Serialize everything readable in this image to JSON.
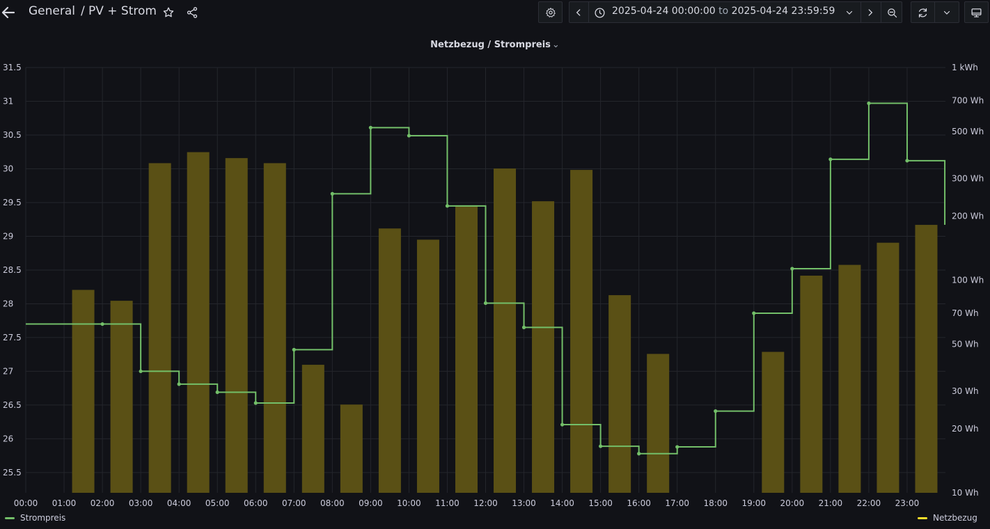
{
  "header": {
    "crumb_general": "General",
    "crumb_separator": "/",
    "crumb_page": "PV + Strom",
    "time_from": "2025-04-24 00:00:00",
    "time_to_word": "to",
    "time_to": "2025-04-24 23:59:59"
  },
  "panel": {
    "title": "Netzbezug / Strompreis"
  },
  "colors": {
    "price_line": "#73bf69",
    "bar_fill": "#5a5015",
    "legend_netzbezug": "#fade2a",
    "grid": "#24262c",
    "axis_text": "#ccccdc"
  },
  "icons": [
    "arrow-left-icon",
    "star-icon",
    "share-icon",
    "gear-icon",
    "chevron-left-icon",
    "clock-icon",
    "chevron-down-icon",
    "chevron-right-icon",
    "zoom-out-icon",
    "refresh-icon",
    "monitor-icon"
  ],
  "chart_data": {
    "type": "bar",
    "title": "Netzbezug / Strompreis",
    "x_ticks": [
      "00:00",
      "01:00",
      "02:00",
      "03:00",
      "04:00",
      "05:00",
      "06:00",
      "07:00",
      "08:00",
      "09:00",
      "10:00",
      "11:00",
      "12:00",
      "13:00",
      "14:00",
      "15:00",
      "16:00",
      "17:00",
      "18:00",
      "19:00",
      "20:00",
      "21:00",
      "22:00",
      "23:00"
    ],
    "y_left": {
      "ticks": [
        "25.5",
        "26",
        "26.5",
        "27",
        "27.5",
        "28",
        "28.5",
        "29",
        "29.5",
        "30",
        "30.5",
        "31",
        "31.5"
      ],
      "range": [
        25.2,
        31.5
      ]
    },
    "y_right": {
      "scale": "log",
      "range_wh": [
        10,
        1000
      ],
      "ticks": [
        {
          "wh": 1000,
          "label": "1 kWh"
        },
        {
          "wh": 700,
          "label": "700 Wh"
        },
        {
          "wh": 500,
          "label": "500 Wh"
        },
        {
          "wh": 300,
          "label": "300 Wh"
        },
        {
          "wh": 200,
          "label": "200 Wh"
        },
        {
          "wh": 100,
          "label": "100 Wh"
        },
        {
          "wh": 70,
          "label": "70 Wh"
        },
        {
          "wh": 50,
          "label": "50 Wh"
        },
        {
          "wh": 30,
          "label": "30 Wh"
        },
        {
          "wh": 20,
          "label": "20 Wh"
        },
        {
          "wh": 10,
          "label": "10 Wh"
        }
      ]
    },
    "series": [
      {
        "name": "Strompreis",
        "type": "line-step",
        "axis": "left",
        "points": [
          {
            "x": "00:00",
            "y": 27.7
          },
          {
            "x": "02:00",
            "y": 27.7
          },
          {
            "x": "03:00",
            "y": 27.0
          },
          {
            "x": "04:00",
            "y": 26.81
          },
          {
            "x": "05:00",
            "y": 26.69
          },
          {
            "x": "06:00",
            "y": 26.53
          },
          {
            "x": "07:00",
            "y": 27.32
          },
          {
            "x": "08:00",
            "y": 29.63
          },
          {
            "x": "09:00",
            "y": 30.61
          },
          {
            "x": "10:00",
            "y": 30.49
          },
          {
            "x": "11:00",
            "y": 29.45
          },
          {
            "x": "12:00",
            "y": 28.01
          },
          {
            "x": "13:00",
            "y": 27.65
          },
          {
            "x": "14:00",
            "y": 26.21
          },
          {
            "x": "15:00",
            "y": 25.89
          },
          {
            "x": "16:00",
            "y": 25.78
          },
          {
            "x": "17:00",
            "y": 25.88
          },
          {
            "x": "18:00",
            "y": 26.41
          },
          {
            "x": "19:00",
            "y": 27.86
          },
          {
            "x": "20:00",
            "y": 28.52
          },
          {
            "x": "21:00",
            "y": 30.14
          },
          {
            "x": "22:00",
            "y": 30.97
          },
          {
            "x": "23:00",
            "y": 30.12
          },
          {
            "x": "23:59",
            "y": 29.18
          }
        ]
      },
      {
        "name": "Netzbezug",
        "type": "bar",
        "axis": "right",
        "unit": "Wh",
        "bars": [
          {
            "x": "01:30",
            "wh": 90
          },
          {
            "x": "02:30",
            "wh": 80
          },
          {
            "x": "03:30",
            "wh": 355
          },
          {
            "x": "04:30",
            "wh": 400
          },
          {
            "x": "05:30",
            "wh": 375
          },
          {
            "x": "06:30",
            "wh": 355
          },
          {
            "x": "07:30",
            "wh": 40
          },
          {
            "x": "08:30",
            "wh": 26
          },
          {
            "x": "09:30",
            "wh": 175
          },
          {
            "x": "10:30",
            "wh": 155
          },
          {
            "x": "11:30",
            "wh": 225
          },
          {
            "x": "12:30",
            "wh": 335
          },
          {
            "x": "13:30",
            "wh": 235
          },
          {
            "x": "14:30",
            "wh": 330
          },
          {
            "x": "15:30",
            "wh": 85
          },
          {
            "x": "16:30",
            "wh": 45
          },
          {
            "x": "19:30",
            "wh": 46
          },
          {
            "x": "20:30",
            "wh": 105
          },
          {
            "x": "21:30",
            "wh": 118
          },
          {
            "x": "22:30",
            "wh": 150
          },
          {
            "x": "23:30",
            "wh": 182
          }
        ]
      }
    ],
    "legend": [
      {
        "name": "Strompreis",
        "position": "bottom-left"
      },
      {
        "name": "Netzbezug",
        "position": "bottom-right"
      }
    ],
    "grid": true
  }
}
